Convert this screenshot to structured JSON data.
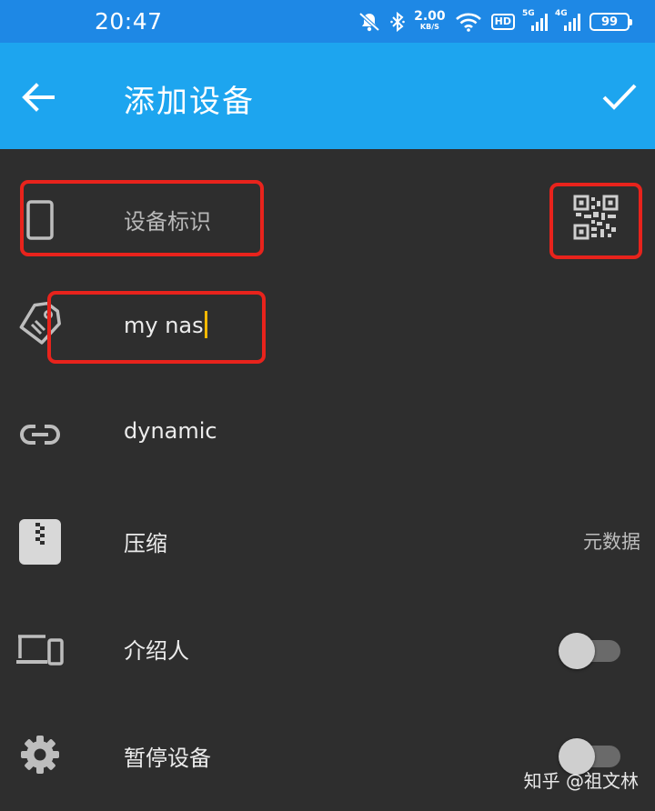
{
  "status_bar": {
    "time": "20:47",
    "net_speed_value": "2.00",
    "net_speed_unit": "KB/S",
    "hd_label": "HD",
    "signal1_label": "5G",
    "signal2_label": "4G",
    "battery": "99",
    "icons": [
      "mute-icon",
      "bluetooth-icon",
      "wifi-icon",
      "hd-icon",
      "signal-5g-icon",
      "signal-4g-icon",
      "battery-icon"
    ]
  },
  "app_bar": {
    "title": "添加设备",
    "back_icon": "arrow-left-icon",
    "confirm_icon": "check-icon"
  },
  "form": {
    "device_id": {
      "placeholder": "设备标识",
      "icon": "phone-icon",
      "scan_icon": "qr-code-icon"
    },
    "device_name": {
      "value": "my nas",
      "icon": "tag-icon"
    },
    "address": {
      "value": "dynamic",
      "icon": "link-icon"
    },
    "compression": {
      "label": "压缩",
      "value": "元数据",
      "icon": "zip-file-icon"
    },
    "introducer": {
      "label": "介绍人",
      "checked": false,
      "icon": "devices-icon"
    },
    "pause_device": {
      "label": "暂停设备",
      "checked": false,
      "icon": "gear-icon"
    }
  },
  "watermark": "知乎 @祖文林",
  "colors": {
    "status_bar": "#1e88e5",
    "app_bar": "#1da5ef",
    "background": "#2e2e2e",
    "highlight": "#e8231c",
    "cursor": "#f5b800"
  }
}
